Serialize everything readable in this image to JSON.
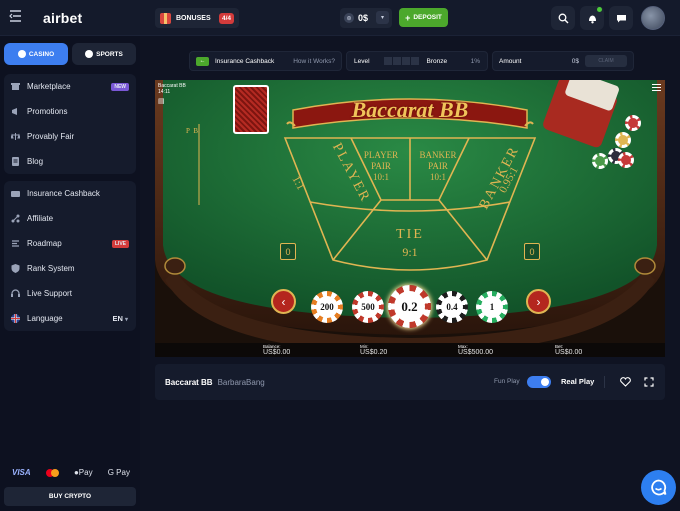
{
  "header": {
    "logo": "airbet",
    "bonuses_label": "BONUSES",
    "bonuses_count": "4/4",
    "balance": "0$",
    "coin_symbol": "⊛",
    "deposit_label": "DEPOSIT"
  },
  "sidebar": {
    "tabs": {
      "casino": "CASINO",
      "sports": "SPORTS"
    },
    "group1": [
      {
        "label": "Marketplace",
        "badge": "NEW"
      },
      {
        "label": "Promotions"
      },
      {
        "label": "Provably Fair"
      },
      {
        "label": "Blog"
      }
    ],
    "group2": [
      {
        "label": "Insurance Cashback"
      },
      {
        "label": "Affiliate"
      },
      {
        "label": "Roadmap",
        "badge": "LIVE"
      },
      {
        "label": "Rank System"
      },
      {
        "label": "Live Support"
      },
      {
        "label": "Language",
        "value": "EN"
      }
    ],
    "payments": [
      "VISA",
      "Pay",
      "G Pay"
    ],
    "buy_crypto": "BUY CRYPTO"
  },
  "info_bar": {
    "insurance_label": "Insurance Cashback",
    "how_it_works": "How it Works?",
    "level_label": "Level",
    "level_name": "Bronze",
    "level_percent": "1%",
    "amount_label": "Amount",
    "amount_value": "0$",
    "claim_label": "CLAIM"
  },
  "game": {
    "title": "Baccarat BB",
    "time": "14:11",
    "table_title": "Baccarat BB",
    "road_labels": [
      "P",
      "B"
    ],
    "player_label": "PLAYER",
    "player_odds": "1:1",
    "player_pair_label": "PLAYER",
    "player_pair_label2": "PAIR",
    "player_pair_odds": "10:1",
    "banker_pair_label": "BANKER",
    "banker_pair_label2": "PAIR",
    "banker_pair_odds": "10:1",
    "banker_label": "BANKER",
    "banker_odds": "0.95:1",
    "tie_label": "TIE",
    "tie_odds": "9:1",
    "left_counter": "0",
    "right_counter": "0",
    "chips": [
      "200",
      "500",
      "0.2",
      "0.4",
      "1"
    ],
    "stats": {
      "balance_label": "Balance:",
      "balance": "US$0.00",
      "min_label": "Min:",
      "min": "US$0.20",
      "max_label": "Max:",
      "max": "US$500.00",
      "bet_label": "Bet:",
      "bet": "US$0.00"
    }
  },
  "game_bar": {
    "name": "Baccarat BB",
    "provider": "BarbaraBang",
    "fun_play": "Fun Play",
    "real_play": "Real Play"
  },
  "colors": {
    "accent": "#3d7ef0",
    "deposit": "#4ca82c",
    "felt": "#1f6b35",
    "gold": "#e0b552",
    "live": "#d33b3b",
    "new": "#7a58d6"
  }
}
